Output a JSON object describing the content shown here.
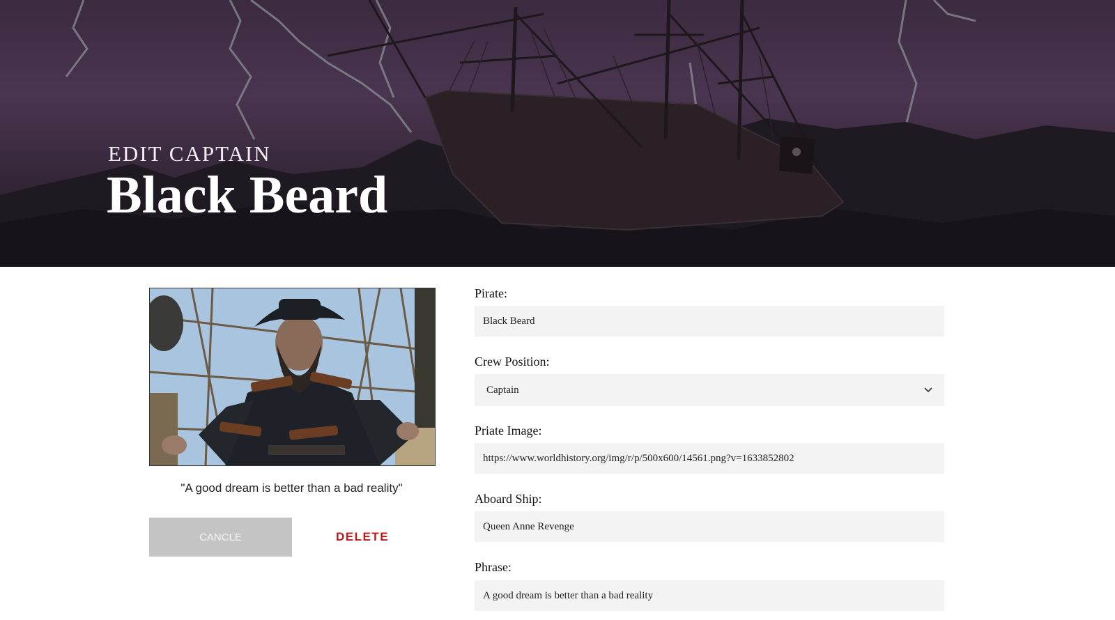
{
  "hero": {
    "subtitle": "EDIT CAPTAIN",
    "title": "Black Beard"
  },
  "profile": {
    "image_alt": "pirate-portrait",
    "quote": "\"A good dream is better than a bad reality\"",
    "cancel_label": "CANCLE",
    "delete_label": "DELETE"
  },
  "form": {
    "pirate": {
      "label": "Pirate:",
      "value": "Black Beard"
    },
    "crew_position": {
      "label": "Crew Position:",
      "value": "Captain"
    },
    "image": {
      "label": "Priate Image:",
      "value": "https://www.worldhistory.org/img/r/p/500x600/14561.png?v=1633852802"
    },
    "ship": {
      "label": "Aboard Ship:",
      "value": "Queen Anne Revenge"
    },
    "phrase": {
      "label": "Phrase:",
      "value": "A good dream is better than a bad reality"
    }
  },
  "colors": {
    "hero_bg": "#3b2a40",
    "delete": "#c01818",
    "cancel_bg": "#c4c4c4",
    "input_bg": "#f3f3f3"
  }
}
